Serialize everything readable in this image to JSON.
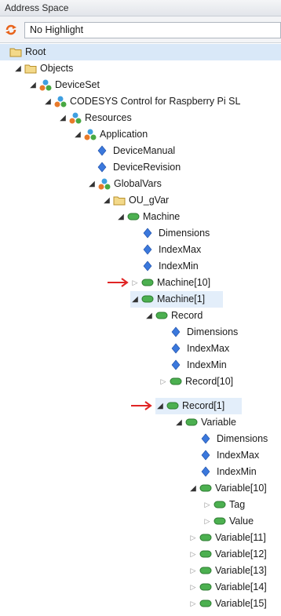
{
  "panel": {
    "title": "Address Space"
  },
  "toolbar": {
    "highlight_icon": "refresh-icon",
    "highlight_value": "No Highlight"
  },
  "tree": {
    "root": "Root",
    "objects": "Objects",
    "deviceset": "DeviceSet",
    "device": "CODESYS Control for Raspberry Pi SL",
    "resources": "Resources",
    "application": "Application",
    "device_manual": "DeviceManual",
    "device_revision": "DeviceRevision",
    "global_vars": "GlobalVars",
    "ou_gvar": "OU_gVar",
    "machine": "Machine",
    "machine_dimensions": "Dimensions",
    "machine_indexmax": "IndexMax",
    "machine_indexmin": "IndexMin",
    "machine_10": "Machine[10]",
    "machine_1": "Machine[1]",
    "record": "Record",
    "record_dimensions": "Dimensions",
    "record_indexmax": "IndexMax",
    "record_indexmin": "IndexMin",
    "record_10": "Record[10]",
    "record_1": "Record[1]",
    "variable": "Variable",
    "variable_dimensions": "Dimensions",
    "variable_indexmax": "IndexMax",
    "variable_indexmin": "IndexMin",
    "variable_10": "Variable[10]",
    "tag": "Tag",
    "value": "Value",
    "variable_11": "Variable[11]",
    "variable_12": "Variable[12]",
    "variable_13": "Variable[13]",
    "variable_14": "Variable[14]",
    "variable_15": "Variable[15]"
  },
  "colors": {
    "folder": "#e8c25a",
    "object": "#45a640",
    "property": "#2f6fd6",
    "arrow": "#e02424",
    "selection": "#d9e8f8"
  },
  "icons": {
    "folder": "folder-icon",
    "object": "object-cube-icon",
    "property": "property-diamond-icon",
    "variable": "variable-pill-icon"
  }
}
